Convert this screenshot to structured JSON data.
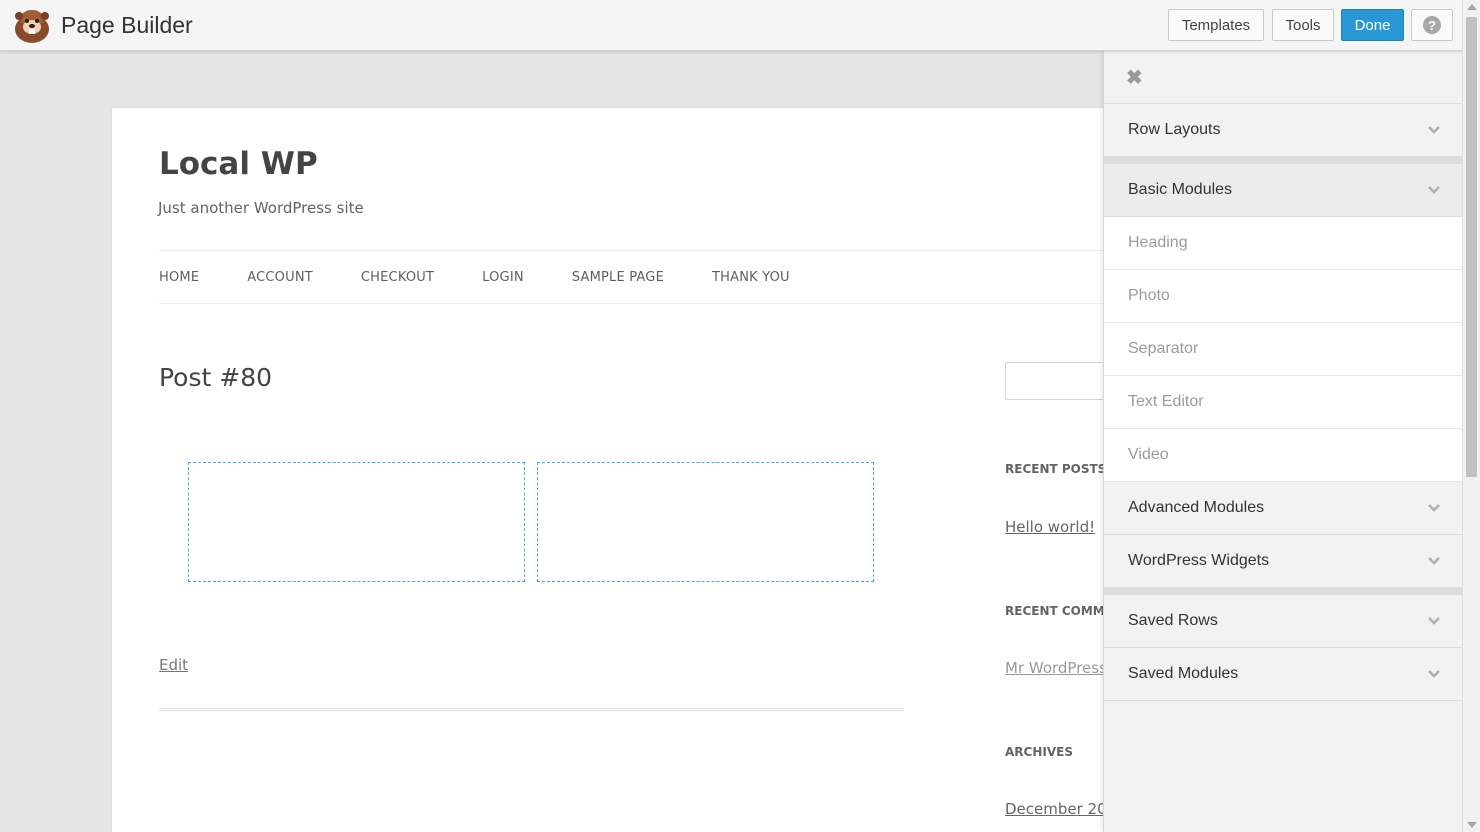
{
  "toolbar": {
    "app_title": "Page Builder",
    "templates_label": "Templates",
    "tools_label": "Tools",
    "done_label": "Done",
    "help_label": "?",
    "logo_icon": "beaver-logo-icon",
    "done_color": "#2996d6"
  },
  "site": {
    "title": "Local WP",
    "tagline": "Just another WordPress site",
    "nav": [
      "HOME",
      "ACCOUNT",
      "CHECKOUT",
      "LOGIN",
      "SAMPLE PAGE",
      "THANK YOU"
    ]
  },
  "post": {
    "title": "Post #80",
    "edit_label": "Edit"
  },
  "sidebar": {
    "recent_posts_title": "RECENT POSTS",
    "recent_post_link": "Hello world!",
    "recent_comments_title": "RECENT COMM",
    "recent_comment_link": "Mr WordPress",
    "archives_title": "ARCHIVES",
    "archive_link": "December 20"
  },
  "panel": {
    "close_icon": "close-icon",
    "sections": {
      "row_layouts": "Row Layouts",
      "basic_modules": "Basic Modules",
      "advanced_modules": "Advanced Modules",
      "wordpress_widgets": "WordPress Widgets",
      "saved_rows": "Saved Rows",
      "saved_modules": "Saved Modules"
    },
    "basic_module_items": [
      "Heading",
      "Photo",
      "Separator",
      "Text Editor",
      "Video"
    ]
  }
}
